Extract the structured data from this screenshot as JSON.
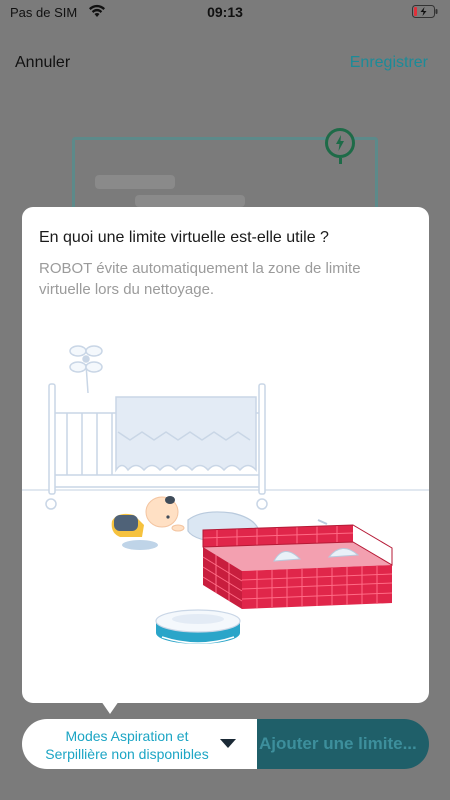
{
  "status_bar": {
    "carrier": "Pas de SIM",
    "time": "09:13",
    "wifi_icon": "wifi-icon",
    "battery_icon": "battery-charging-icon"
  },
  "nav": {
    "cancel_label": "Annuler",
    "save_label": "Enregistrer"
  },
  "modal": {
    "title": "En quoi une limite virtuelle est-elle utile ?",
    "description": "ROBOT évite automatiquement la zone de limite virtuelle lors du nettoyage."
  },
  "bottom_bar": {
    "mode_label_line1": "Modes Aspiration et",
    "mode_label_line2": "Serpillière non disponibles",
    "add_button_label": "Ajouter une limite..."
  },
  "colors": {
    "accent": "#1c8b98",
    "mode_text": "#1ca5c4",
    "add_button_bg": "#1f5f69",
    "restricted_zone": "#e0264a",
    "overlay": "#7b7b7b"
  }
}
